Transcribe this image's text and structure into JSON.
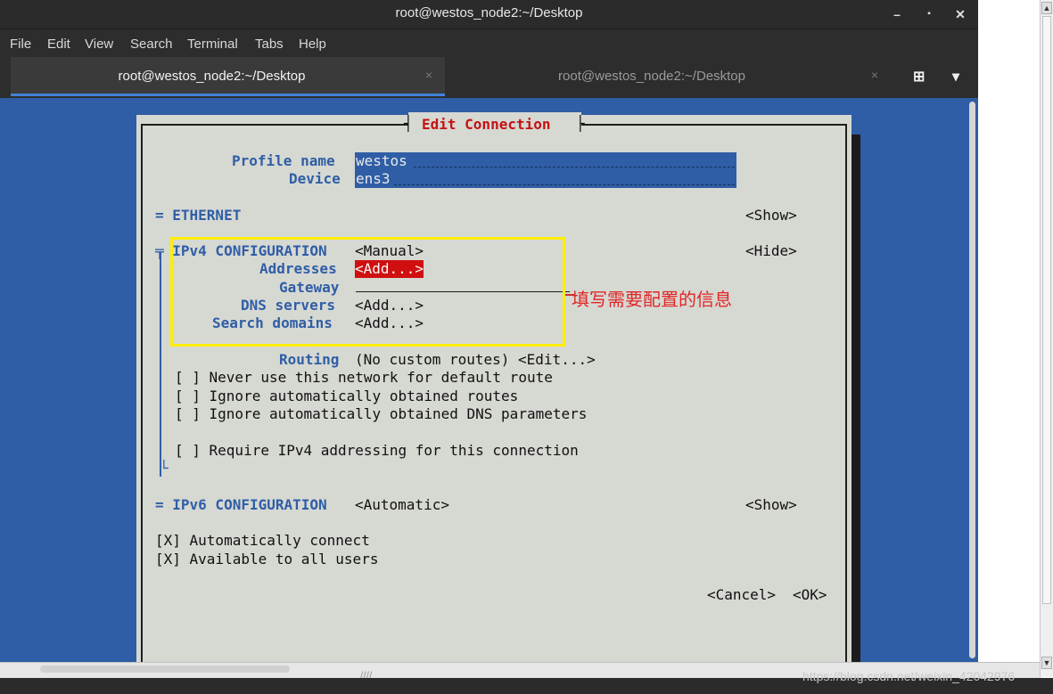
{
  "window": {
    "title": "root@westos_node2:~/Desktop",
    "minimize": "–",
    "maximize": "▪",
    "close": "✕"
  },
  "menu": [
    "File",
    "Edit",
    "View",
    "Search",
    "Terminal",
    "Tabs",
    "Help"
  ],
  "tabs": [
    {
      "label": "root@westos_node2:~/Desktop",
      "close": "×",
      "active": true
    },
    {
      "label": "root@westos_node2:~/Desktop",
      "close": "×",
      "active": false
    }
  ],
  "tab_actions": {
    "new_tab_icon": "new-tab-icon",
    "new_tab": "⊞",
    "dropdown": "▾"
  },
  "dialog": {
    "title": "Edit Connection",
    "profile_label": "Profile name",
    "profile_value": "westos",
    "device_label": "Device",
    "device_value": "ens3",
    "ethernet_label": "= ETHERNET",
    "ethernet_action": "<Show>",
    "ipv4_label": "╤ IPv4 CONFIGURATION",
    "ipv4_mode": "<Manual>",
    "ipv4_action": "<Hide>",
    "addresses_label": "Addresses",
    "addresses_value": "<Add...>",
    "gateway_label": "Gateway",
    "dns_label": "DNS servers",
    "dns_value": "<Add...>",
    "search_label": "Search domains",
    "search_value": "<Add...>",
    "routing_label": "Routing",
    "routing_value": "(No custom routes) <Edit...>",
    "check_never_default": "[ ] Never use this network for default route",
    "check_ignore_routes": "[ ] Ignore automatically obtained routes",
    "check_ignore_dns": "[ ] Ignore automatically obtained DNS parameters",
    "check_require_ipv4": "[ ] Require IPv4 addressing for this connection",
    "ipv6_label": "= IPv6 CONFIGURATION",
    "ipv6_mode": "<Automatic>",
    "ipv6_action": "<Show>",
    "check_auto_connect": "[X] Automatically connect",
    "check_all_users": "[X] Available to all users",
    "cancel": "<Cancel>",
    "ok": "<OK>"
  },
  "annotation": {
    "text": "填写需要配置的信息",
    "box_color": "#ffee00",
    "text_color": "#e12626"
  },
  "watermark": "https://blog.csdn.net/weixin_42042976",
  "colors": {
    "terminal_bg": "#2f5ea6",
    "dialog_bg": "#d6d8d2",
    "accent_red": "#d01010"
  }
}
